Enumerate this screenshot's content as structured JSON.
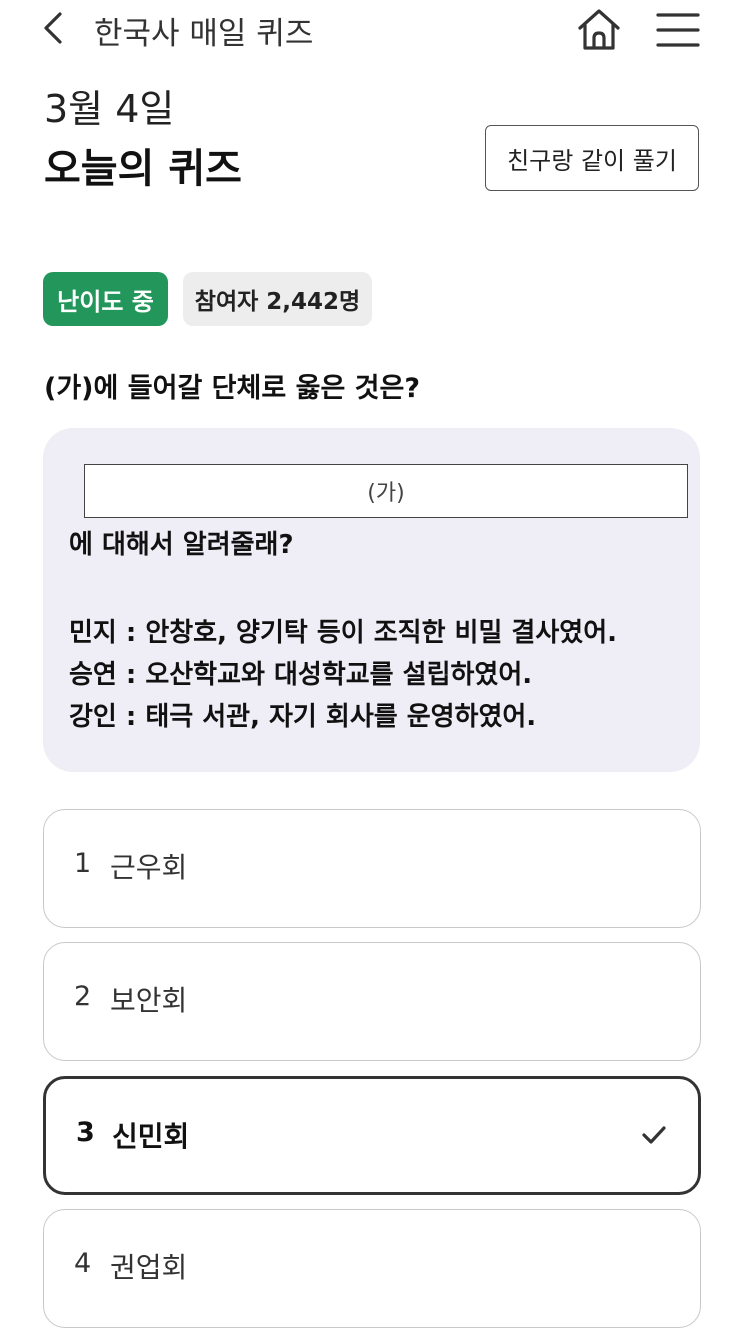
{
  "header": {
    "app_title": "한국사 매일 퀴즈",
    "back_icon": "chevron-left-icon",
    "home_icon": "home-icon",
    "menu_icon": "hamburger-menu-icon"
  },
  "quiz": {
    "date": "3월 4일",
    "title": "오늘의 퀴즈",
    "share_button": "친구랑 같이 풀기",
    "level_badge": "난이도 중",
    "participants_badge": "참여자 2,442명",
    "question": "(가)에 들어갈 단체로 옳은 것은?"
  },
  "passage": {
    "blank": "(가)",
    "prompt": "에 대해서 알려줄래?",
    "lines": [
      "민지 : 안창호, 양기탁 등이 조직한 비밀 결사였어.",
      "승연 : 오산학교와 대성학교를 설립하였어.",
      "강인 : 태극 서관, 자기 회사를 운영하였어."
    ]
  },
  "choices": [
    {
      "num": "1",
      "label": "근우회",
      "selected": false
    },
    {
      "num": "2",
      "label": "보안회",
      "selected": false
    },
    {
      "num": "3",
      "label": "신민회",
      "selected": true
    },
    {
      "num": "4",
      "label": "권업회",
      "selected": false
    }
  ],
  "colors": {
    "accent_green": "#23975b",
    "passage_bg": "#efeef6",
    "badge_gray": "#ededed"
  }
}
